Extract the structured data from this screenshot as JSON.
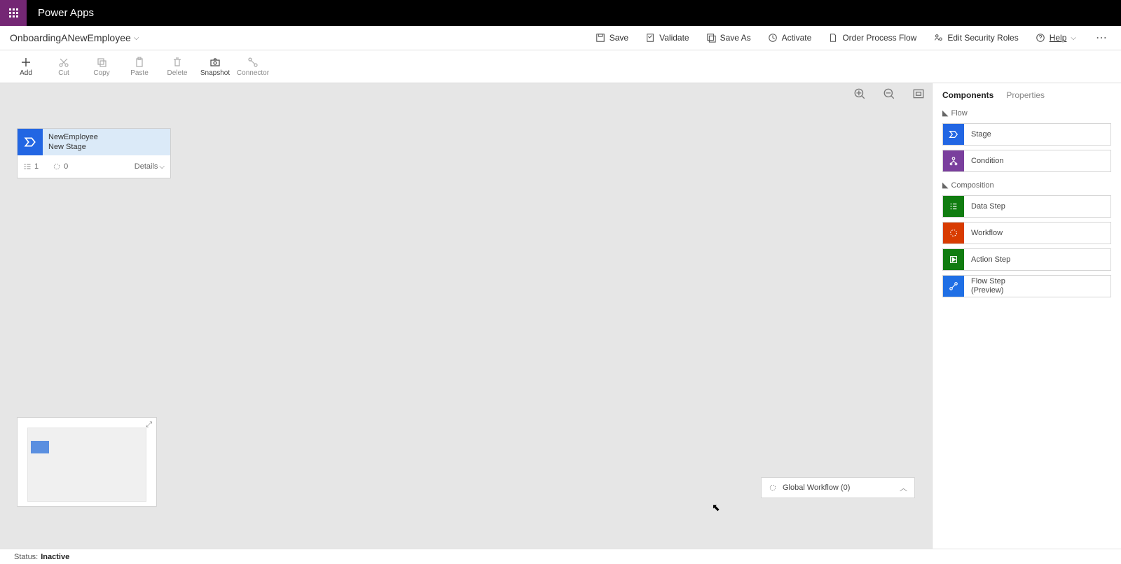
{
  "header": {
    "app_name": "Power Apps",
    "flow_name": "OnboardingANewEmployee"
  },
  "commandbar": {
    "save": "Save",
    "validate": "Validate",
    "save_as": "Save As",
    "activate": "Activate",
    "order_process_flow": "Order Process Flow",
    "edit_security_roles": "Edit Security Roles",
    "help": "Help"
  },
  "toolbar": {
    "add": "Add",
    "cut": "Cut",
    "copy": "Copy",
    "paste": "Paste",
    "delete": "Delete",
    "snapshot": "Snapshot",
    "connector": "Connector"
  },
  "stage_card": {
    "entity": "NewEmployee",
    "stage_name": "New Stage",
    "steps_count": "1",
    "workflow_count": "0",
    "details_label": "Details"
  },
  "global_workflow": {
    "label": "Global Workflow (0)"
  },
  "rightpanel": {
    "tab_components": "Components",
    "tab_properties": "Properties",
    "group_flow": "Flow",
    "group_composition": "Composition",
    "items": {
      "stage": "Stage",
      "condition": "Condition",
      "data_step": "Data Step",
      "workflow": "Workflow",
      "action_step": "Action Step",
      "flow_step": "Flow Step\n(Preview)"
    }
  },
  "status": {
    "label": "Status:",
    "value": "Inactive"
  }
}
